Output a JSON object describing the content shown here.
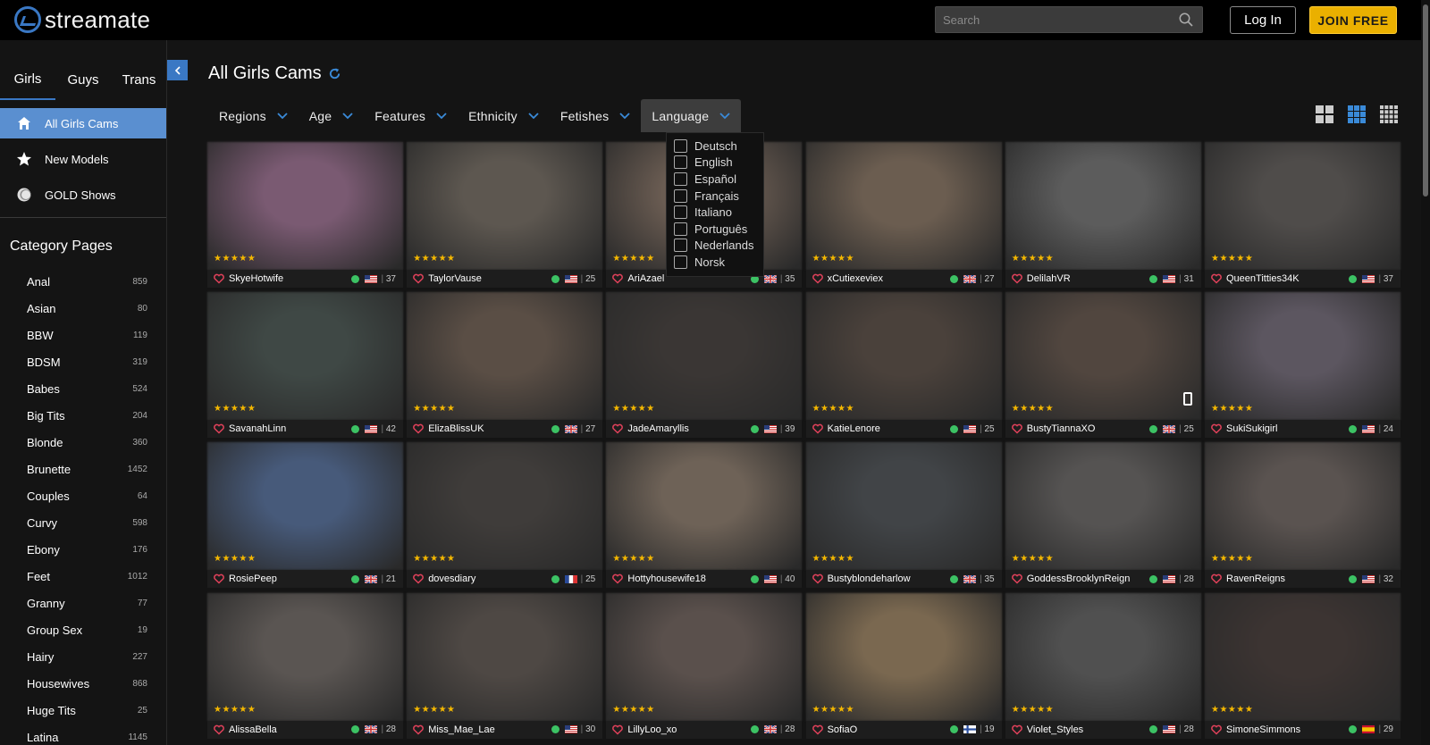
{
  "header": {
    "logo_text": "streamate",
    "search_placeholder": "Search",
    "login_label": "Log In",
    "join_label": "JOIN FREE"
  },
  "sidebar": {
    "tabs": [
      "Girls",
      "Guys",
      "Trans"
    ],
    "nav": [
      {
        "label": "All Girls Cams",
        "icon": "home-icon",
        "active": true
      },
      {
        "label": "New Models",
        "icon": "star-icon",
        "active": false
      },
      {
        "label": "GOLD Shows",
        "icon": "gold-coin-icon",
        "active": false
      }
    ],
    "category_title": "Category Pages",
    "categories": [
      {
        "name": "Anal",
        "count": "859"
      },
      {
        "name": "Asian",
        "count": "80"
      },
      {
        "name": "BBW",
        "count": "119"
      },
      {
        "name": "BDSM",
        "count": "319"
      },
      {
        "name": "Babes",
        "count": "524"
      },
      {
        "name": "Big Tits",
        "count": "204"
      },
      {
        "name": "Blonde",
        "count": "360"
      },
      {
        "name": "Brunette",
        "count": "1452"
      },
      {
        "name": "Couples",
        "count": "64"
      },
      {
        "name": "Curvy",
        "count": "598"
      },
      {
        "name": "Ebony",
        "count": "176"
      },
      {
        "name": "Feet",
        "count": "1012"
      },
      {
        "name": "Granny",
        "count": "77"
      },
      {
        "name": "Group Sex",
        "count": "19"
      },
      {
        "name": "Hairy",
        "count": "227"
      },
      {
        "name": "Housewives",
        "count": "868"
      },
      {
        "name": "Huge Tits",
        "count": "25"
      },
      {
        "name": "Latina",
        "count": "1145"
      }
    ]
  },
  "main": {
    "title": "All Girls Cams",
    "filters": [
      {
        "label": "Regions",
        "open": false
      },
      {
        "label": "Age",
        "open": false
      },
      {
        "label": "Features",
        "open": false
      },
      {
        "label": "Ethnicity",
        "open": false
      },
      {
        "label": "Fetishes",
        "open": false
      },
      {
        "label": "Language",
        "open": true
      }
    ],
    "language_options": [
      "Deutsch",
      "English",
      "Español",
      "Français",
      "Italiano",
      "Português",
      "Nederlands",
      "Norsk"
    ],
    "stars": "★★★★★",
    "models": [
      {
        "name": "SkyeHotwife",
        "flag": "us",
        "age": "37",
        "tone": "#7a5a72"
      },
      {
        "name": "TaylorVause",
        "flag": "us",
        "age": "25",
        "tone": "#5d5750"
      },
      {
        "name": "AriAzael",
        "flag": "uk",
        "age": "35",
        "tone": "#6a5c52"
      },
      {
        "name": "xCutiexeviex",
        "flag": "uk",
        "age": "27",
        "tone": "#6b5d50"
      },
      {
        "name": "DelilahVR",
        "flag": "us",
        "age": "31",
        "tone": "#5c5c5c"
      },
      {
        "name": "QueenTitties34K",
        "flag": "us",
        "age": "37",
        "tone": "#4f4c4a"
      },
      {
        "name": "SavanahLinn",
        "flag": "us",
        "age": "42",
        "tone": "#3f4845"
      },
      {
        "name": "ElizaBlissUK",
        "flag": "uk",
        "age": "27",
        "tone": "#5a4e45"
      },
      {
        "name": "JadeAmaryllis",
        "flag": "us",
        "age": "39",
        "tone": "#3a3634"
      },
      {
        "name": "KatieLenore",
        "flag": "us",
        "age": "25",
        "tone": "#4a413b"
      },
      {
        "name": "BustyTiannaXO",
        "flag": "uk",
        "age": "25",
        "tone": "#51463f",
        "mobile": true
      },
      {
        "name": "SukiSukigirl",
        "flag": "us",
        "age": "24",
        "tone": "#5c5660"
      },
      {
        "name": "RosiePeep",
        "flag": "uk",
        "age": "21",
        "tone": "#475a7a"
      },
      {
        "name": "dovesdiary",
        "flag": "fr",
        "age": "25",
        "tone": "#3f3c3a"
      },
      {
        "name": "Hottyhousewife18",
        "flag": "us",
        "age": "40",
        "tone": "#6e6257"
      },
      {
        "name": "Bustyblondeharlow",
        "flag": "uk",
        "age": "35",
        "tone": "#414447"
      },
      {
        "name": "GoddessBrooklynReign",
        "flag": "us",
        "age": "28",
        "tone": "#555352"
      },
      {
        "name": "RavenReigns",
        "flag": "us",
        "age": "32",
        "tone": "#5a5350"
      },
      {
        "name": "AlissaBella",
        "flag": "uk",
        "age": "28",
        "tone": "#5a5552"
      },
      {
        "name": "Miss_Mae_Lae",
        "flag": "us",
        "age": "30",
        "tone": "#4e4844"
      },
      {
        "name": "LillyLoo_xo",
        "flag": "uk",
        "age": "28",
        "tone": "#5a504c"
      },
      {
        "name": "SofiaO",
        "flag": "fi",
        "age": "19",
        "tone": "#7a6850"
      },
      {
        "name": "Violet_Styles",
        "flag": "us",
        "age": "28",
        "tone": "#505050"
      },
      {
        "name": "SimoneSimmons",
        "flag": "es",
        "age": "29",
        "tone": "#3c3432"
      }
    ]
  },
  "colors": {
    "accent": "#3a78c4",
    "join": "#eab000",
    "online": "#3cc264",
    "star": "#f5b800"
  }
}
